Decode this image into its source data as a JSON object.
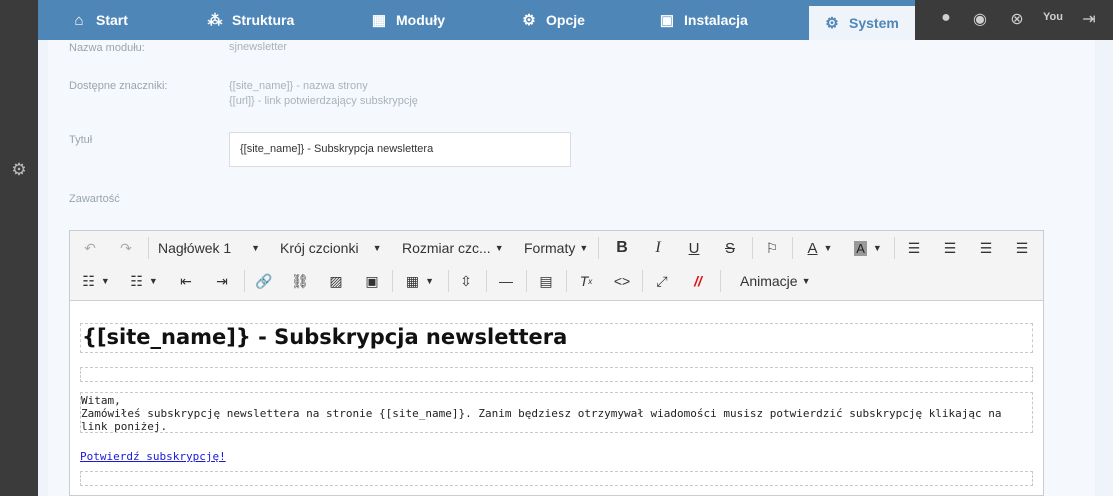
{
  "nav": {
    "tabs": [
      {
        "label": "Start",
        "icon": "home-icon"
      },
      {
        "label": "Struktura",
        "icon": "sitemap-icon"
      },
      {
        "label": "Moduły",
        "icon": "modules-icon"
      },
      {
        "label": "Opcje",
        "icon": "gear-icon"
      },
      {
        "label": "Instalacja",
        "icon": "install-icon"
      },
      {
        "label": "System",
        "icon": "gear-icon"
      }
    ],
    "active": "System"
  },
  "right_icons": [
    "user-icon",
    "eye-icon",
    "lifebuoy-icon",
    "youtube-icon",
    "logout-icon"
  ],
  "form": {
    "module_name_label": "Nazwa modułu:",
    "module_name_value": "sjnewsletter",
    "tags_label": "Dostępne znaczniki:",
    "tag_1": "{[site_name]} - nazwa strony",
    "tag_2": "{[url]} - link potwierdzający subskrypcję",
    "title_label": "Tytuł",
    "title_value": "{[site_name]} - Subskrypcja newslettera",
    "content_label": "Zawartość"
  },
  "toolbar": {
    "heading": "Nagłówek 1",
    "font_family": "Krój czcionki",
    "font_size": "Rozmiar czc...",
    "formats": "Formaty",
    "animations": "Animacje"
  },
  "content": {
    "heading": "{[site_name]} - Subskrypcja newslettera",
    "greeting": "Witam,",
    "body": "Zamówiłeś subskrypcję newslettera na stronie {[site_name]}. Zanim będziesz otrzymywał wiadomości musisz potwierdzić subskrypcję klikając na link poniżej.",
    "link": "Potwierdź subskrypcję!"
  }
}
